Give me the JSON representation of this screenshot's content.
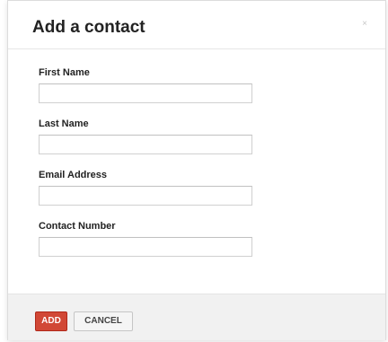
{
  "dialog": {
    "title": "Add a contact",
    "close_glyph": "×"
  },
  "form": {
    "fields": [
      {
        "label": "First Name",
        "value": "",
        "placeholder": ""
      },
      {
        "label": "Last Name",
        "value": "",
        "placeholder": ""
      },
      {
        "label": "Email Address",
        "value": "",
        "placeholder": ""
      },
      {
        "label": "Contact Number",
        "value": "",
        "placeholder": ""
      }
    ]
  },
  "footer": {
    "add_label": "ADD",
    "cancel_label": "CANCEL"
  },
  "colors": {
    "primary_button": "#d14836",
    "footer_background": "#f1f1f1"
  }
}
